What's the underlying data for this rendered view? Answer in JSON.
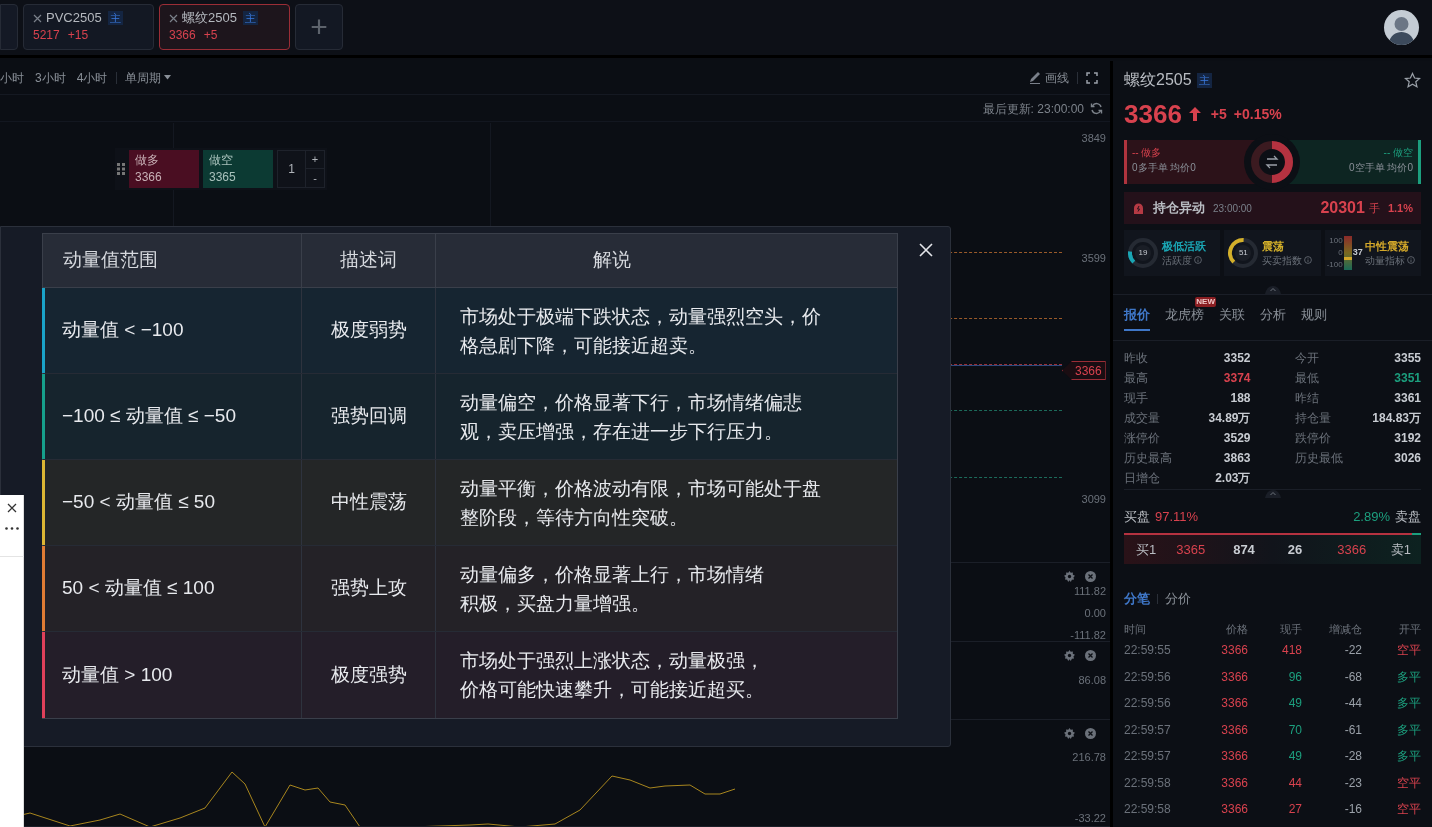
{
  "tabs": [
    {
      "symbol": "PVC2505",
      "badge": "主",
      "price": "5217",
      "change": "+15",
      "selected": false
    },
    {
      "symbol": "螺纹2505",
      "badge": "主",
      "price": "3366",
      "change": "+5",
      "selected": true
    }
  ],
  "add_tab": "+",
  "toolbar": {
    "periods": [
      "小时",
      "3小时",
      "4小时"
    ],
    "period_mode": "单周期",
    "draw_button": "画线",
    "last_update": "最后更新: 23:00:00"
  },
  "chart": {
    "axis_labels": [
      "3849",
      "3599",
      "3099"
    ],
    "price_tag": "3366"
  },
  "order_widget": {
    "long": {
      "label": "做多",
      "price": "3366"
    },
    "short": {
      "label": "做空",
      "price": "3365"
    },
    "quantity": "1",
    "plus": "+",
    "minus": "-"
  },
  "subpanels": [
    {
      "ticks": [
        "111.82",
        "0.00",
        "-111.82"
      ]
    },
    {
      "ticks": [
        "86.08"
      ]
    },
    {
      "ticks": [
        "216.78",
        "-33.22"
      ]
    }
  ],
  "modal": {
    "columns": [
      "动量值范围",
      "描述词",
      "解说"
    ],
    "rows": [
      {
        "range": "动量值 < −100",
        "term": "极度弱势",
        "explanation": [
          "市场处于极端下跌状态，动量强烈空头，价",
          "格急剧下降，可能接近超卖。"
        ],
        "color": "#1aa3c8"
      },
      {
        "range": "−100 ≤ 动量值 ≤ −50",
        "term": "强势回调",
        "explanation": [
          "动量偏空，价格显著下行，市场情绪偏悲",
          "观，卖压增强，存在进一步下行压力。"
        ],
        "color": "#16a08c"
      },
      {
        "range": "−50 < 动量值 ≤ 50",
        "term": "中性震荡",
        "explanation": [
          "动量平衡，价格波动有限，市场可能处于盘",
          "整阶段，等待方向性突破。"
        ],
        "color": "#dcb634"
      },
      {
        "range": "50 < 动量值 ≤ 100",
        "term": "强势上攻",
        "explanation": [
          "动量偏多，价格显著上行，市场情绪",
          "积极，买盘力量增强。"
        ],
        "color": "#e07c34"
      },
      {
        "range": "动量值 > 100",
        "term": "极度强势",
        "explanation": [
          "市场处于强烈上涨状态，动量极强，",
          "价格可能快速攀升，可能接近超买。"
        ],
        "color": "#e0405a"
      }
    ]
  },
  "instrument": {
    "symbol": "螺纹2505",
    "badge": "主",
    "price": "3366",
    "change": "+5",
    "change_pct": "+0.15%"
  },
  "long_short": {
    "long": {
      "label": "-- 做多",
      "detail": "0多手单 均价0"
    },
    "short": {
      "label": "-- 做空",
      "detail": "0空手单 均价0"
    },
    "level": 0.5
  },
  "alert": {
    "title": "持仓异动",
    "time": "23:00:00",
    "value": "20301",
    "unit": "手",
    "pct": "1.1%"
  },
  "indicators": [
    {
      "kind": "gauge",
      "value": "19",
      "level": 0.19,
      "title": "极低活跃",
      "subtitle": "活跃度",
      "color": "#1aa6b4"
    },
    {
      "kind": "gauge",
      "value": "51",
      "level": 0.51,
      "title": "震荡",
      "subtitle": "买卖指数",
      "color": "#d4b02a"
    },
    {
      "kind": "bar",
      "value": "37",
      "level": 0.37,
      "scale": [
        "100",
        "0",
        "-100"
      ],
      "title": "中性震荡",
      "subtitle": "动量指标",
      "color": "#d4a82a"
    }
  ],
  "panel_tabs": [
    {
      "label": "报价",
      "selected": true
    },
    {
      "label": "龙虎榜",
      "badge": "NEW",
      "selected": false
    },
    {
      "label": "关联",
      "selected": false
    },
    {
      "label": "分析",
      "selected": false
    },
    {
      "label": "规则",
      "selected": false
    }
  ],
  "quote": [
    {
      "label": "昨收",
      "value": "3352",
      "color": "#c8ccd2"
    },
    {
      "label": "今开",
      "value": "3355",
      "color": "#c8ccd2"
    },
    {
      "label": "最高",
      "value": "3374",
      "color": "#d8424e"
    },
    {
      "label": "最低",
      "value": "3351",
      "color": "#1c9f7e"
    },
    {
      "label": "现手",
      "value": "188",
      "color": "#c8ccd2"
    },
    {
      "label": "昨结",
      "value": "3361",
      "color": "#c8ccd2"
    },
    {
      "label": "成交量",
      "value": "34.89万",
      "color": "#c8ccd2"
    },
    {
      "label": "持仓量",
      "value": "184.83万",
      "color": "#c8ccd2"
    },
    {
      "label": "涨停价",
      "value": "3529",
      "color": "#c8ccd2"
    },
    {
      "label": "跌停价",
      "value": "3192",
      "color": "#c8ccd2"
    },
    {
      "label": "历史最高",
      "value": "3863",
      "color": "#c8ccd2"
    },
    {
      "label": "历史最低",
      "value": "3026",
      "color": "#c8ccd2"
    },
    {
      "label": "日增仓",
      "value": "2.03万",
      "color": "#c8ccd2"
    }
  ],
  "book": {
    "buy_label": "买盘",
    "buy_pct": "97.11%",
    "sell_pct": "2.89%",
    "sell_label": "卖盘",
    "level": 0.9711,
    "row": {
      "bid_label": "买1",
      "bid_price": "3365",
      "bid_volume": "874",
      "ask_volume": "26",
      "ask_price": "3366",
      "ask_label": "卖1"
    }
  },
  "trade_tabs": [
    {
      "label": "分笔",
      "selected": true
    },
    {
      "label": "分价",
      "selected": false
    }
  ],
  "trades": {
    "columns": [
      "时间",
      "价格",
      "现手",
      "增减仓",
      "开平"
    ],
    "rows": [
      {
        "time": "22:59:55",
        "price": "3366",
        "volume": "418",
        "color": "#d8424e",
        "change": "-22",
        "action": "空平"
      },
      {
        "time": "22:59:56",
        "price": "3366",
        "volume": "96",
        "color": "#1c9f7e",
        "change": "-68",
        "action": "多平"
      },
      {
        "time": "22:59:56",
        "price": "3366",
        "volume": "49",
        "color": "#1c9f7e",
        "change": "-44",
        "action": "多平"
      },
      {
        "time": "22:59:57",
        "price": "3366",
        "volume": "70",
        "color": "#1c9f7e",
        "change": "-61",
        "action": "多平"
      },
      {
        "time": "22:59:57",
        "price": "3366",
        "volume": "49",
        "color": "#1c9f7e",
        "change": "-28",
        "action": "多平"
      },
      {
        "time": "22:59:58",
        "price": "3366",
        "volume": "44",
        "color": "#d8424e",
        "change": "-23",
        "action": "空平"
      },
      {
        "time": "22:59:58",
        "price": "3366",
        "volume": "27",
        "color": "#d8424e",
        "change": "-16",
        "action": "空平"
      }
    ]
  }
}
